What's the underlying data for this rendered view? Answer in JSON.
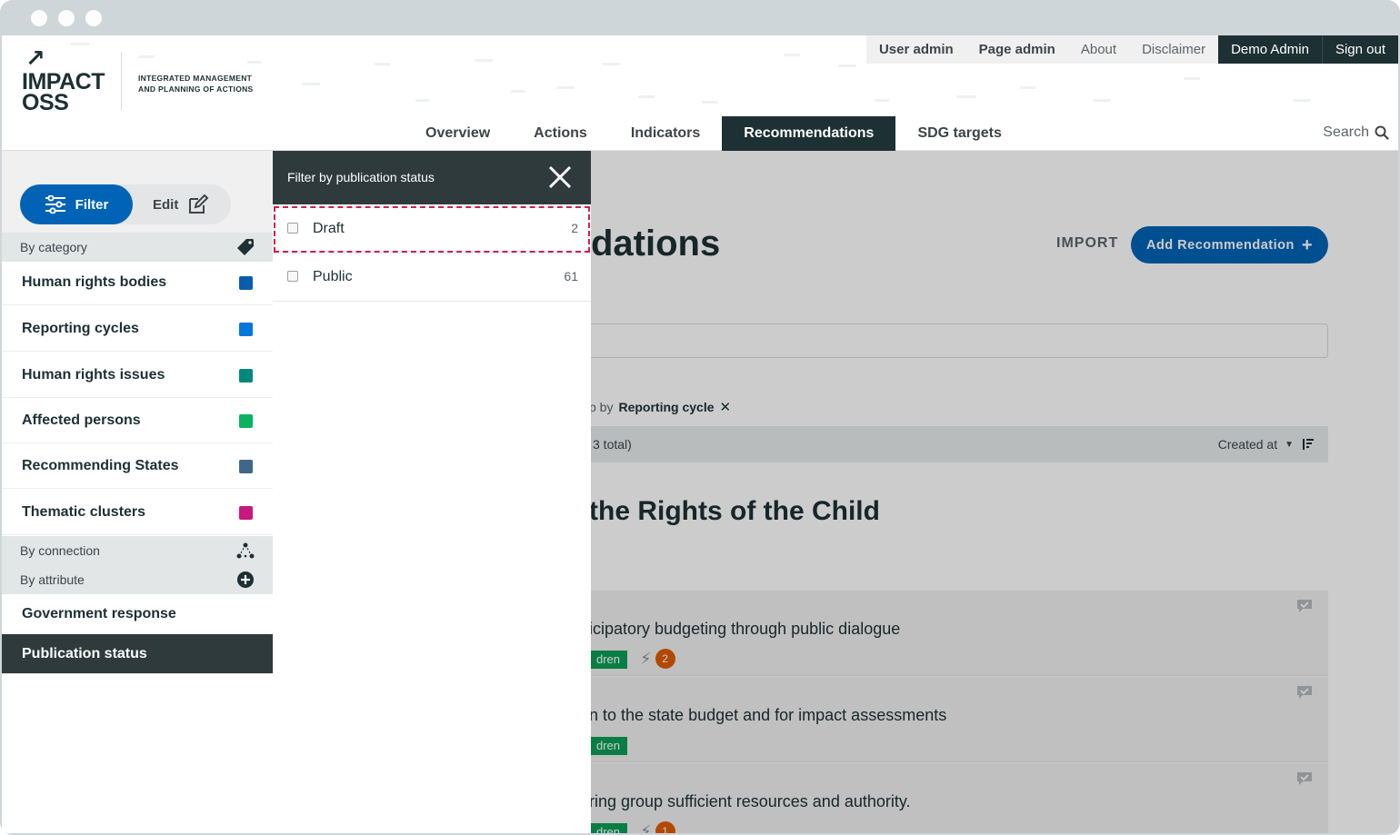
{
  "header": {
    "logo_line1": "IMPACT",
    "logo_line2": "OSS",
    "claim_line1": "INTEGRATED MANAGEMENT",
    "claim_line2": "AND PLANNING OF ACTIONS",
    "topnav": [
      "User admin",
      "Page admin",
      "About",
      "Disclaimer",
      "Demo Admin",
      "Sign out"
    ],
    "mainnav": [
      "Overview",
      "Actions",
      "Indicators",
      "Recommendations",
      "SDG targets"
    ],
    "mainnav_active": "Recommendations",
    "search_label": "Search"
  },
  "sidebar": {
    "toggle_filter": "Filter",
    "toggle_edit": "Edit",
    "by_category": "By category",
    "categories": [
      {
        "label": "Human rights bodies",
        "color": "#0a5cad"
      },
      {
        "label": "Reporting cycles",
        "color": "#0077db"
      },
      {
        "label": "Human rights issues",
        "color": "#00897b"
      },
      {
        "label": "Affected persons",
        "color": "#0bb35e"
      },
      {
        "label": "Recommending States",
        "color": "#3f6888"
      },
      {
        "label": "Thematic clusters",
        "color": "#c7197e"
      }
    ],
    "by_connection": "By connection",
    "by_attribute": "By attribute",
    "attributes": [
      "Government response",
      "Publication status"
    ],
    "active_attribute": "Publication status"
  },
  "filter_panel": {
    "title": "Filter by publication status",
    "options": [
      {
        "label": "Draft",
        "count": "2"
      },
      {
        "label": "Public",
        "count": "61"
      }
    ]
  },
  "main": {
    "page_title_visible": "dations",
    "import_label": "IMPORT",
    "add_label": "Add Recommendation",
    "groupby_prefix": "p by",
    "groupby_value": "Reporting cycle",
    "list_count": "3 total)",
    "sort_label": "Created at",
    "group_title": "the Rights of the Child",
    "items": [
      {
        "text": "icipatory budgeting through public dialogue",
        "tag": "dren",
        "connections": "2"
      },
      {
        "text": "n to the state budget and for impact assessments",
        "tag": "dren",
        "connections": ""
      },
      {
        "text": "ring group sufficient resources and authority.",
        "tag": "dren",
        "connections": "1"
      }
    ]
  },
  "colors": {
    "brand_dark": "#1d3033",
    "primary_blue": "#0063b5",
    "highlight_dash": "#d21f4a"
  }
}
